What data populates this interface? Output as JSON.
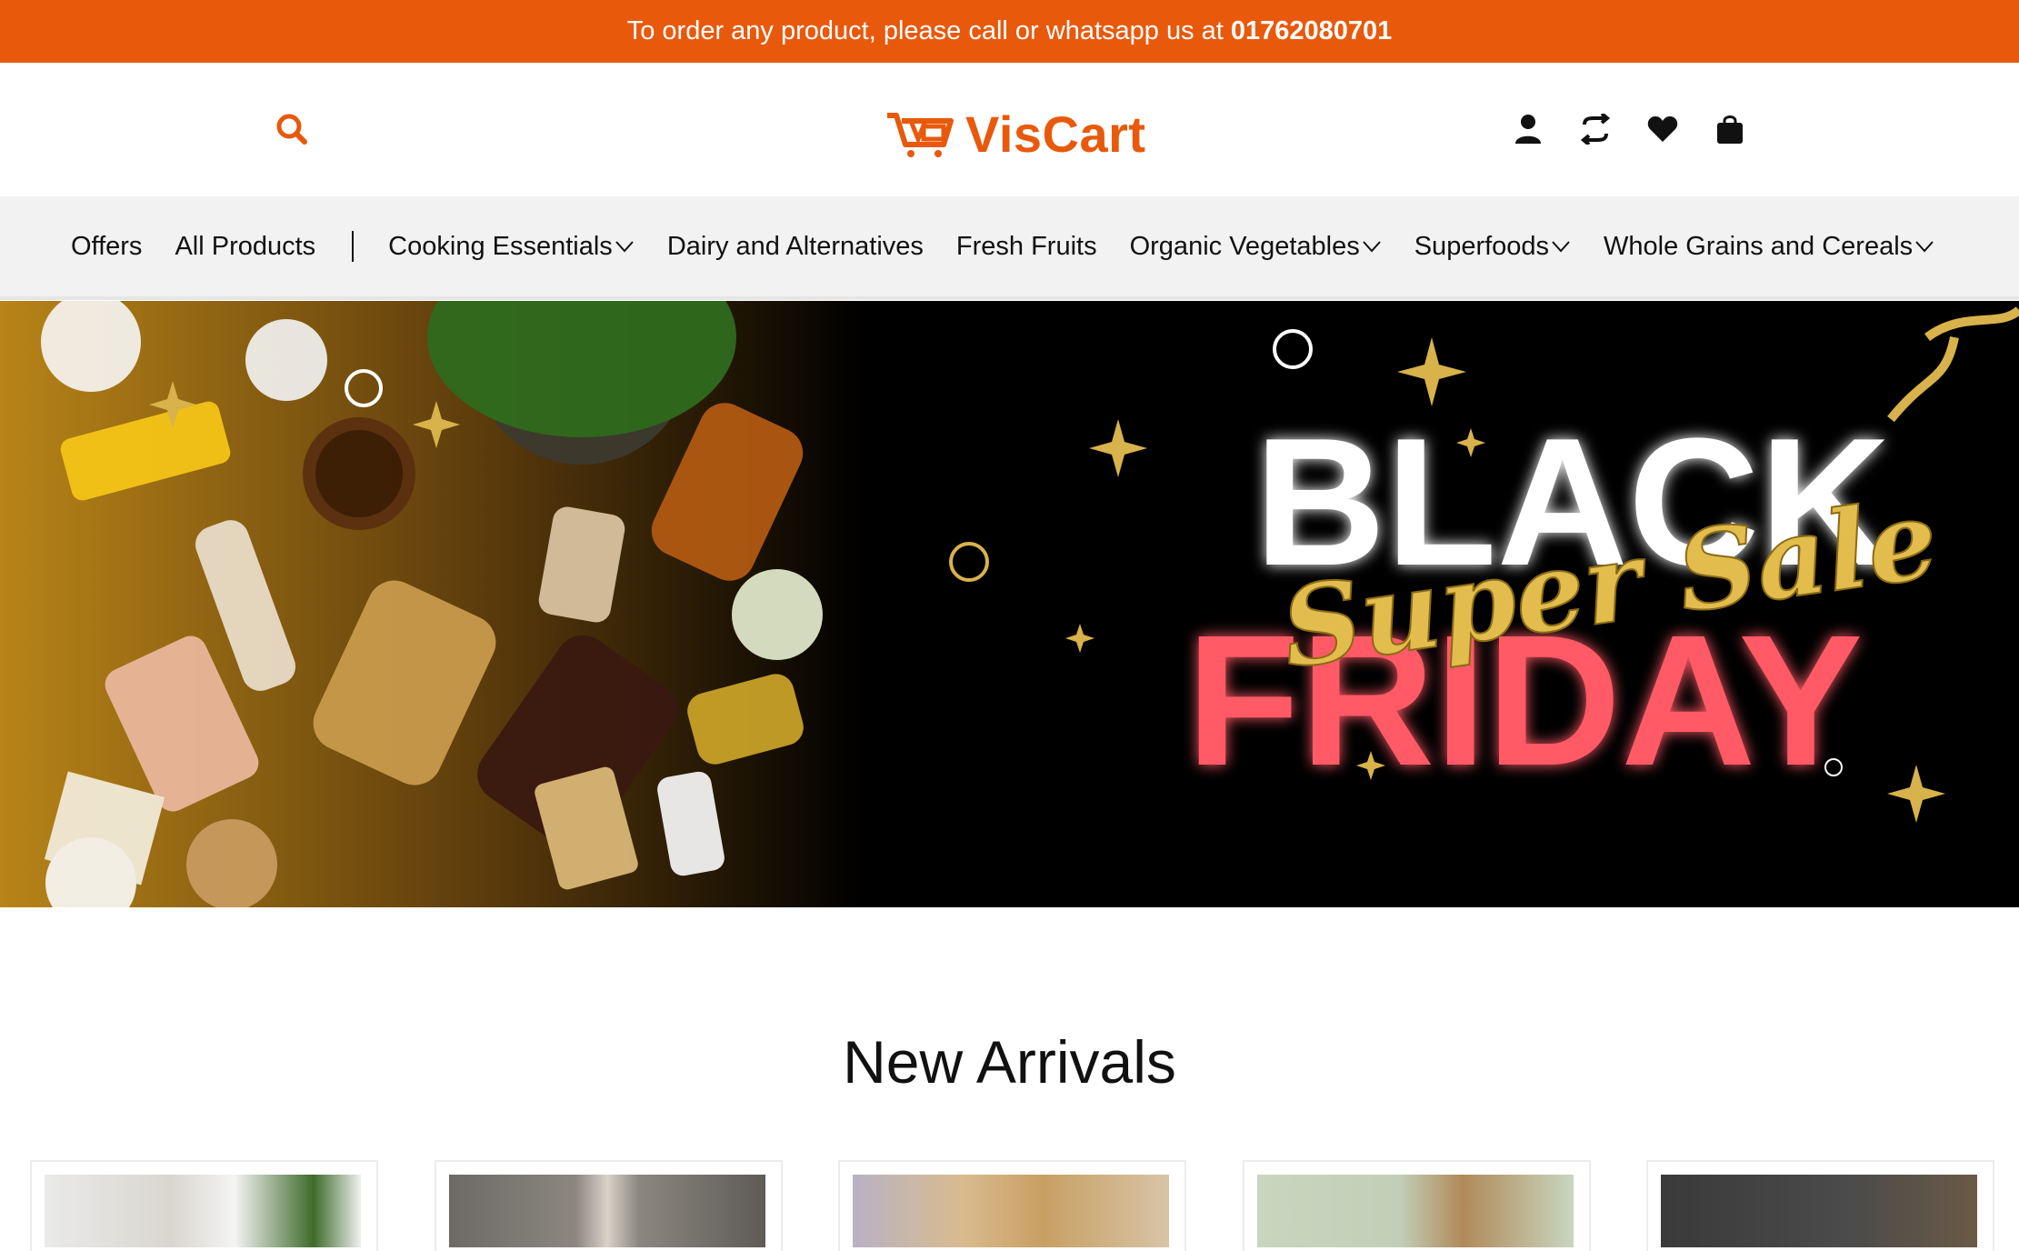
{
  "announcement": {
    "text": "To order any product, please call or whatsapp us at",
    "phone": "01762080701"
  },
  "header": {
    "brand": "VisCart",
    "icons": [
      "search-icon",
      "user-icon",
      "compare-icon",
      "heart-icon",
      "bag-icon"
    ]
  },
  "nav": {
    "items": [
      {
        "label": "Offers",
        "dropdown": false
      },
      {
        "label": "All Products",
        "dropdown": false
      },
      {
        "label": "Cooking Essentials",
        "dropdown": true
      },
      {
        "label": "Dairy and Alternatives",
        "dropdown": false
      },
      {
        "label": "Fresh Fruits",
        "dropdown": false
      },
      {
        "label": "Organic Vegetables",
        "dropdown": true
      },
      {
        "label": "Superfoods",
        "dropdown": true
      },
      {
        "label": "Whole Grains and Cereals",
        "dropdown": true
      }
    ]
  },
  "hero": {
    "line1": "BLACK",
    "script": "Super Sale",
    "line2": "FRIDAY"
  },
  "new_arrivals": {
    "title": "New Arrivals"
  },
  "colors": {
    "accent": "#e8590c",
    "nav_bg": "#f2f2f2",
    "hero_red": "#ff5a66",
    "hero_gold": "#d8b24a"
  }
}
